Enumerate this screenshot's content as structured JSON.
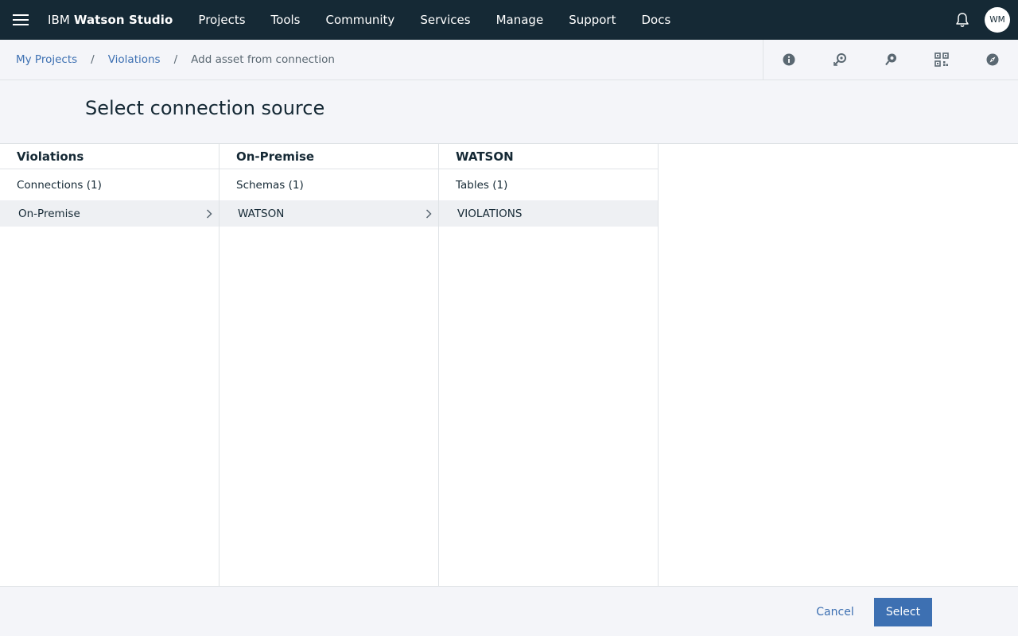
{
  "topnav": {
    "brand_prefix": "IBM ",
    "brand_name": "Watson Studio",
    "items": [
      "Projects",
      "Tools",
      "Community",
      "Services",
      "Manage",
      "Support",
      "Docs"
    ],
    "avatar_initials": "WM",
    "icons": [
      "menu-icon",
      "bell-icon"
    ]
  },
  "breadcrumb": {
    "items": [
      "My Projects",
      "Violations"
    ],
    "separator": "/",
    "current": "Add asset from connection"
  },
  "toolbar": {
    "icons": [
      "info-icon",
      "find-data-icon",
      "community-icon",
      "qr-grid-icon",
      "compass-icon"
    ]
  },
  "page": {
    "title": "Select connection source"
  },
  "columns": [
    {
      "header": "Violations",
      "sub": "Connections (1)",
      "item": "On-Premise",
      "has_chevron": true
    },
    {
      "header": "On-Premise",
      "sub": "Schemas (1)",
      "item": "WATSON",
      "has_chevron": true
    },
    {
      "header": "WATSON",
      "sub": "Tables (1)",
      "item": "VIOLATIONS",
      "has_chevron": false
    }
  ],
  "footer": {
    "cancel_label": "Cancel",
    "select_label": "Select"
  },
  "colors": {
    "topnav_bg": "#152935",
    "accent": "#3d70b2",
    "page_bg": "#f4f5f9",
    "selected_row": "#eef0f3"
  }
}
